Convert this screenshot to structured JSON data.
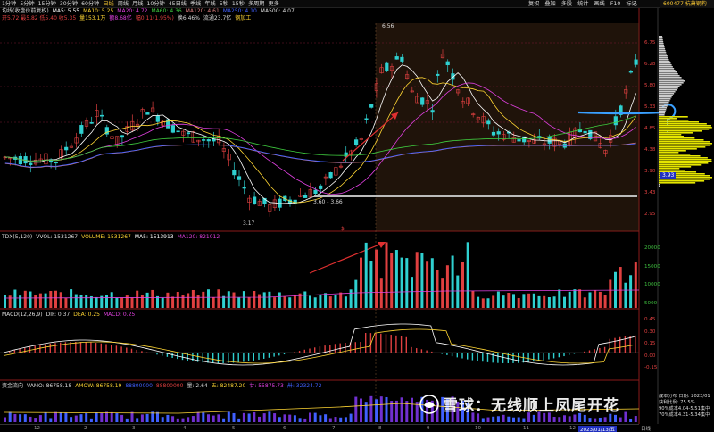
{
  "toolbar": {
    "periods": [
      "1分钟",
      "5分钟",
      "15分钟",
      "30分钟",
      "60分钟",
      "日线",
      "周线",
      "月线",
      "10分钟",
      "45日线",
      "季线",
      "年线",
      "5秒",
      "15秒",
      "多周期",
      "更多"
    ],
    "active_period": "日线",
    "right_items": [
      "复权",
      "叠加",
      "多股",
      "统计",
      "画线",
      "F10",
      "标记"
    ],
    "stock_name": "600477 杭萧钢构"
  },
  "price_legend": {
    "name": "均线(收盘价前复权)",
    "ma5": "MA5: 5.55",
    "ma10": "MA10: 5.25",
    "ma20": "MA20: 4.72",
    "ma60": "MA60: 4.36",
    "ma120": "MA120: 4.61",
    "ma250": "MA250: 4.10",
    "ma500": "MA500: 4.07"
  },
  "price_row2": {
    "ohlc": "开5.72 最5.82 低5.40 收5.35",
    "vol": "量153.1万",
    "amount": "额8.68亿",
    "chg": "幅0.11(1.95%)",
    "turn": "换6.46%",
    "cap": "流通23.7亿",
    "sector": "钢加工"
  },
  "price_annotations": {
    "high": "6.56",
    "low": "3.17",
    "range": "3.60 - 3.66",
    "cursor_price": "3.93",
    "marker": "$"
  },
  "price_axis": [
    "6.75",
    "6.28",
    "5.80",
    "5.33",
    "4.85",
    "4.38",
    "3.90",
    "3.43",
    "2.95"
  ],
  "vol_legend": {
    "name": "TDX(5,120)",
    "vvol": "VVOL: 1531267",
    "volume": "VOLUME: 1531267",
    "ma5": "MA5: 1513913",
    "ma120": "MA120: 821012"
  },
  "vol_axis": [
    "20000",
    "15000",
    "10000",
    "5000"
  ],
  "macd_legend": {
    "name": "MACD(12,26,9)",
    "dif": "DIF: 0.37",
    "dea": "DEA: 0.25",
    "macd": "MACD: 0.25"
  },
  "macd_axis": [
    "0.45",
    "0.30",
    "0.15",
    "0.00",
    "-0.15"
  ],
  "vamo_legend": {
    "name": "资金流向",
    "vamo": "VAMO: 86758.18",
    "amow": "AMOW: 86758.19",
    "v3": "88800000",
    "v4": "88800000",
    "v5": "量: 2.64",
    "v6": "五: 82487.20",
    "v7": "廿: 55875.73",
    "v8": "卅: 32324.72"
  },
  "dates": [
    "12",
    "2",
    "3",
    "4",
    "5",
    "6",
    "7",
    "8",
    "9",
    "10",
    "11",
    "12",
    "2023/01/13/五"
  ],
  "watermark": "雪球：无线顺上凤尾开花",
  "info_panel": [
    "成本分布 日期: 2023/01",
    "获利比例: 75.5%",
    "90%成本4.04-5.51集中",
    "70%成本4.31-5.34集中"
  ],
  "bottom_right": "日线"
}
